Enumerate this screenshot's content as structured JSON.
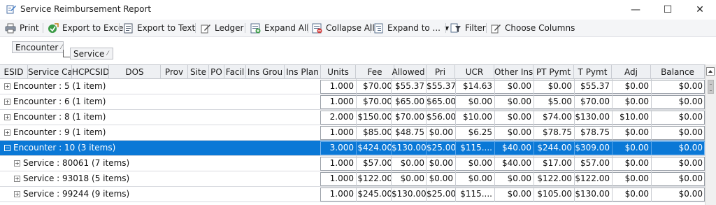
{
  "window": {
    "title": "Service Reimbursement Report",
    "controls": {
      "minimize": "—",
      "maximize": "☐",
      "close": "✕"
    }
  },
  "toolbar": {
    "print": "Print",
    "export_excel": "Export to Excel",
    "export_text": "Export to Text",
    "ledger": "Ledger",
    "expand_all": "Expand All",
    "collapse_all": "Collapse All",
    "expand_to": "Expand to ...",
    "filter": "Filter",
    "choose_columns": "Choose Columns"
  },
  "group_panel": {
    "chips": [
      {
        "label": "Encounter",
        "pin": "⁄"
      },
      {
        "label": "Service",
        "pin": "⁄"
      }
    ]
  },
  "columns": [
    "ESID",
    "Service Cat",
    "HCPCSID",
    "DOS",
    "Prov",
    "Site",
    "PO",
    "Facil",
    "Ins Grou",
    "Ins Plan",
    "Units",
    "Fee",
    "Allowed",
    "Pri",
    "UCR",
    "Other Ins",
    "PT Pymt",
    "T Pymt",
    "Adj",
    "Balance"
  ],
  "rows": [
    {
      "label": "Encounter : 5 (1 item)",
      "level": 0,
      "selected": false,
      "expander": "+",
      "values": [
        "1.000",
        "$70.00",
        "$55.37",
        "$55.37",
        "$14.63",
        "$0.00",
        "$0.00",
        "$55.37",
        "$0.00",
        "$0.00"
      ]
    },
    {
      "label": "Encounter : 6 (1 item)",
      "level": 0,
      "selected": false,
      "expander": "+",
      "values": [
        "1.000",
        "$70.00",
        "$65.00",
        "$65.00",
        "$0.00",
        "$0.00",
        "$5.00",
        "$70.00",
        "$0.00",
        "$0.00"
      ]
    },
    {
      "label": "Encounter : 8 (1 item)",
      "level": 0,
      "selected": false,
      "expander": "+",
      "values": [
        "2.000",
        "$150.00",
        "$70.00",
        "$56.00",
        "$10.00",
        "$0.00",
        "$74.00",
        "$130.00",
        "$10.00",
        "$0.00"
      ]
    },
    {
      "label": "Encounter : 9 (1 item)",
      "level": 0,
      "selected": false,
      "expander": "+",
      "values": [
        "1.000",
        "$85.00",
        "$48.75",
        "$0.00",
        "$6.25",
        "$0.00",
        "$78.75",
        "$78.75",
        "$0.00",
        "$0.00"
      ]
    },
    {
      "label": "Encounter : 10 (3 items)",
      "level": 0,
      "selected": true,
      "expander": "−",
      "values": [
        "3.000",
        "$424.00",
        "$130.00",
        "$25.00",
        "$115....",
        "$40.00",
        "$244.00",
        "$309.00",
        "$0.00",
        "$0.00"
      ]
    },
    {
      "label": "Service : 80061 (7 items)",
      "level": 1,
      "selected": false,
      "expander": "+",
      "values": [
        "1.000",
        "$57.00",
        "$0.00",
        "$0.00",
        "$0.00",
        "$40.00",
        "$17.00",
        "$57.00",
        "$0.00",
        "$0.00"
      ]
    },
    {
      "label": "Service : 93018 (5 items)",
      "level": 1,
      "selected": false,
      "expander": "+",
      "values": [
        "1.000",
        "$122.00",
        "$0.00",
        "$0.00",
        "$0.00",
        "$0.00",
        "$122.00",
        "$122.00",
        "$0.00",
        "$0.00"
      ]
    },
    {
      "label": "Service : 99244 (9 items)",
      "level": 1,
      "selected": false,
      "expander": "+",
      "values": [
        "1.000",
        "$245.00",
        "$130.00",
        "$25.00",
        "$115....",
        "$0.00",
        "$105.00",
        "$130.00",
        "$0.00",
        "$0.00"
      ]
    }
  ],
  "colors": {
    "selection": "#0a78d6",
    "header_bg": "#eef0f3",
    "toolbar_bg": "#f4f5f7"
  }
}
